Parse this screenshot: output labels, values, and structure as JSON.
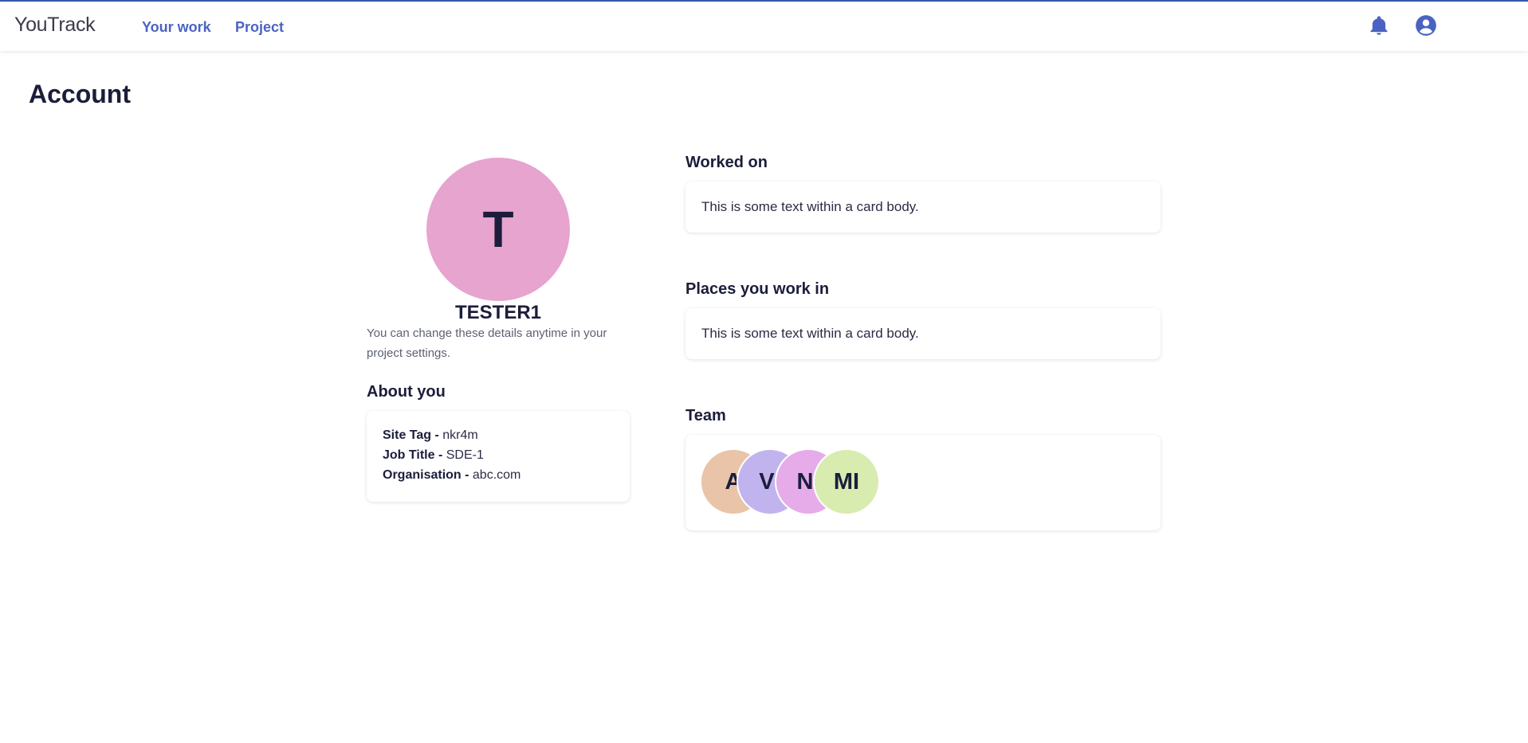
{
  "header": {
    "brand": "YouTrack",
    "nav": [
      {
        "label": "Your work"
      },
      {
        "label": "Project"
      }
    ],
    "icons": [
      "bell-icon",
      "user-circle-icon"
    ],
    "accent_color": "#4a63c2"
  },
  "page": {
    "title": "Account"
  },
  "profile": {
    "avatar_letter": "T",
    "avatar_color": "#e6a4cf",
    "username": "TESTER1",
    "hint": "You can change these details anytime in your project settings.",
    "about_title": "About you",
    "about": {
      "site_tag_label": "Site Tag -",
      "site_tag_value": "nkr4m",
      "job_title_label": "Job Title -",
      "job_title_value": "SDE-1",
      "org_label": "Organisation -",
      "org_value": "abc.com"
    }
  },
  "worked_on": {
    "title": "Worked on",
    "body": "This is some text within a card body."
  },
  "places": {
    "title": "Places you work in",
    "body": "This is some text within a card body."
  },
  "team": {
    "title": "Team",
    "members": [
      {
        "initials": "A",
        "color": "#e9c4a8"
      },
      {
        "initials": "VI",
        "color": "#c1b4ee"
      },
      {
        "initials": "NI",
        "color": "#e6acea"
      },
      {
        "initials": "MI",
        "color": "#d8ecb0"
      }
    ]
  }
}
